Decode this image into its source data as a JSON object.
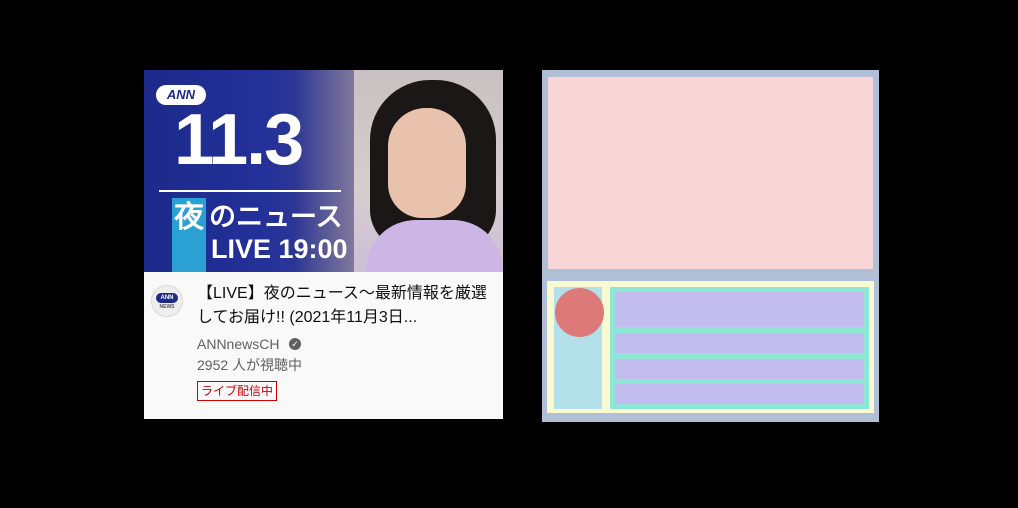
{
  "video": {
    "thumbnail": {
      "logo": "ANN",
      "date": "11.3",
      "yoru": "夜",
      "program": "のニュース",
      "live_time": "LIVE 19:00"
    },
    "channel_avatar": {
      "logo": "ANN",
      "sub": "NEWS"
    },
    "title": "【LIVE】夜のニュース～最新情報を厳選してお届け!! (2021年11月3日...",
    "channel": "ANNnewsCH",
    "verified_icon": "check-circle-icon",
    "viewers": "2952 人が視聴中",
    "badge": "ライブ配信中"
  },
  "colors": {
    "background": "#000000",
    "card": "#f9f9f9",
    "live_badge": "#cc0000",
    "wire_frame": "#b1bfd6",
    "wire_thumbnail": "#f8d6d8",
    "wire_details": "#fafad2",
    "wire_avatar_col": "#b3e0e9",
    "wire_avatar": "#dd7a79",
    "wire_text_col": "#8ee6d5",
    "wire_text_line": "#c3bdef"
  }
}
